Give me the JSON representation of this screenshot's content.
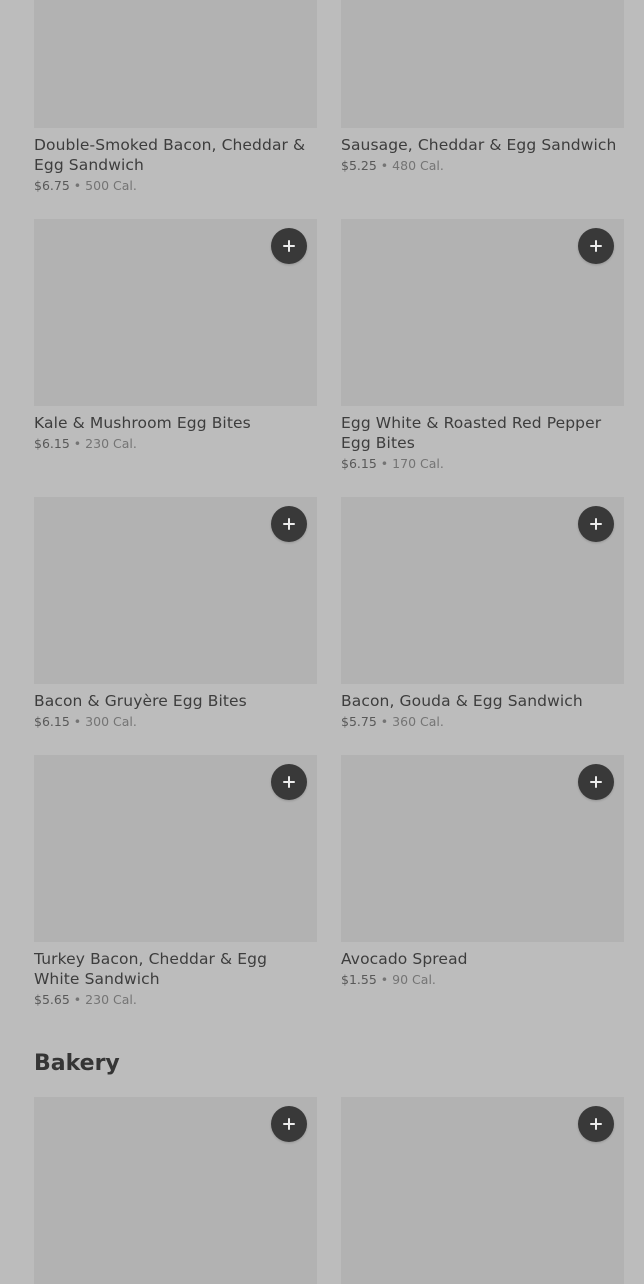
{
  "items": [
    {
      "name": "Double-Smoked Bacon, Cheddar & Egg Sandwich",
      "price": "$6.75",
      "calories": "500 Cal."
    },
    {
      "name": "Sausage, Cheddar & Egg Sandwich",
      "price": "$5.25",
      "calories": "480 Cal."
    },
    {
      "name": "Kale & Mushroom Egg Bites",
      "price": "$6.15",
      "calories": "230 Cal."
    },
    {
      "name": "Egg White & Roasted Red Pepper Egg Bites",
      "price": "$6.15",
      "calories": "170 Cal."
    },
    {
      "name": "Bacon & Gruyère Egg Bites",
      "price": "$6.15",
      "calories": "300 Cal."
    },
    {
      "name": "Bacon, Gouda & Egg Sandwich",
      "price": "$5.75",
      "calories": "360 Cal."
    },
    {
      "name": "Turkey Bacon, Cheddar & Egg White Sandwich",
      "price": "$5.65",
      "calories": "230 Cal."
    },
    {
      "name": "Avocado Spread",
      "price": "$1.55",
      "calories": "90 Cal."
    }
  ],
  "section": {
    "title": "Bakery"
  },
  "ui": {
    "separator": "•",
    "add_icon": "plus-icon",
    "overlay_color": "#bcbcbc",
    "image_placeholder_color": "#b2b2b2",
    "add_button_color": "#393939"
  }
}
